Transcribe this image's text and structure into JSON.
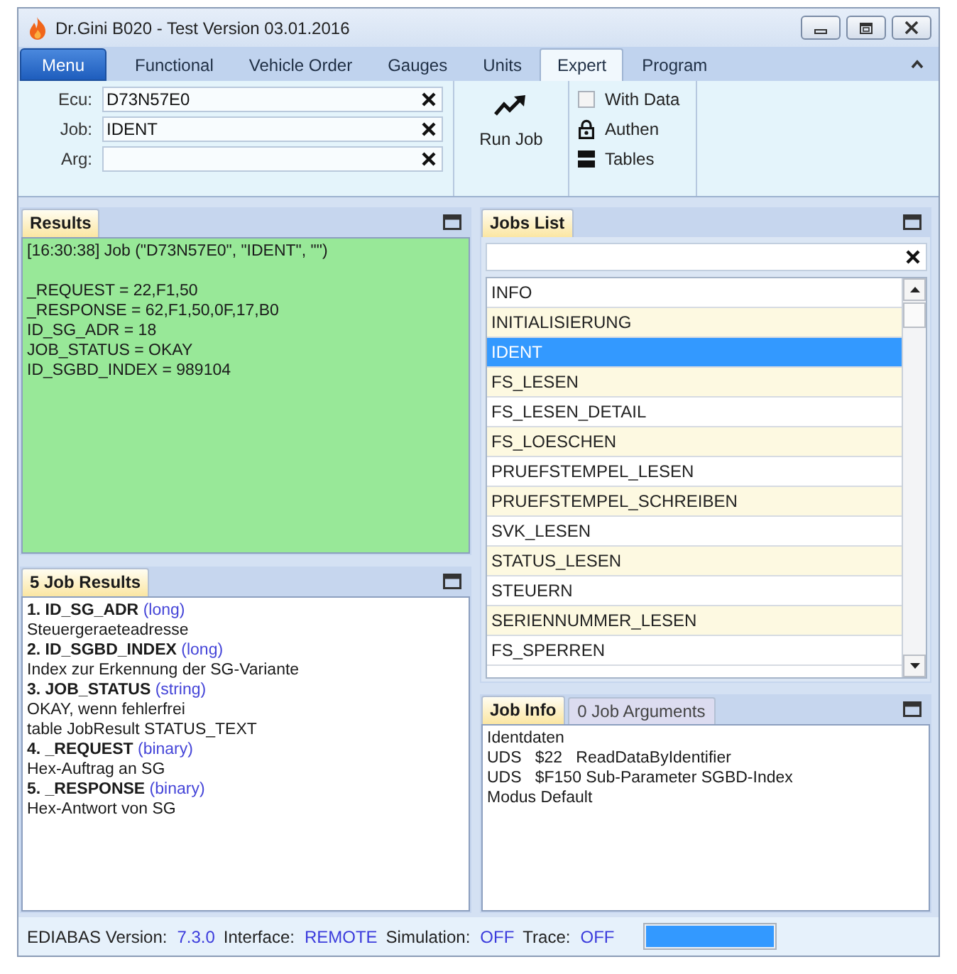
{
  "window": {
    "title": "Dr.Gini B020 - Test Version 03.01.2016"
  },
  "menu_button": "Menu",
  "tabs": [
    {
      "label": "Functional",
      "selected": false
    },
    {
      "label": "Vehicle Order",
      "selected": false
    },
    {
      "label": "Gauges",
      "selected": false
    },
    {
      "label": "Units",
      "selected": false
    },
    {
      "label": "Expert",
      "selected": true
    },
    {
      "label": "Program",
      "selected": false
    }
  ],
  "ribbon": {
    "fields": [
      {
        "label": "Ecu:",
        "value": "D73N57E0"
      },
      {
        "label": "Job:",
        "value": "IDENT"
      },
      {
        "label": "Arg:"
      }
    ],
    "run_button": "Run Job",
    "options": [
      {
        "kind": "checkbox",
        "label": "With Data",
        "checked": false
      },
      {
        "kind": "lock",
        "label": "Authen"
      },
      {
        "kind": "table",
        "label": "Tables"
      }
    ]
  },
  "results": {
    "title": "Results",
    "command": "[16:30:38] Job (\"D73N57E0\", \"IDENT\", \"\")",
    "lines": [
      "_REQUEST = 22,F1,50",
      "_RESPONSE = 62,F1,50,0F,17,B0",
      "ID_SG_ADR = 18",
      "JOB_STATUS = OKAY",
      "ID_SGBD_INDEX = 989104"
    ]
  },
  "jobs_list": {
    "title": "Jobs List",
    "jobs": [
      {
        "label": "INFO",
        "selected": false
      },
      {
        "label": "INITIALISIERUNG",
        "selected": false
      },
      {
        "label": "IDENT",
        "selected": true
      },
      {
        "label": "FS_LESEN",
        "selected": false
      },
      {
        "label": "FS_LESEN_DETAIL",
        "selected": false
      },
      {
        "label": "FS_LOESCHEN",
        "selected": false
      },
      {
        "label": "PRUEFSTEMPEL_LESEN",
        "selected": false
      },
      {
        "label": "PRUEFSTEMPEL_SCHREIBEN",
        "selected": false
      },
      {
        "label": "SVK_LESEN",
        "selected": false
      },
      {
        "label": "STATUS_LESEN",
        "selected": false
      },
      {
        "label": "STEUERN",
        "selected": false
      },
      {
        "label": "SERIENNUMMER_LESEN",
        "selected": false
      },
      {
        "label": "FS_SPERREN",
        "selected": false
      }
    ]
  },
  "job_results": {
    "title": "5 Job Results",
    "items": [
      {
        "name": "1. ID_SG_ADR",
        "type": "(long)",
        "description": [
          "Steuergeraeteadresse"
        ]
      },
      {
        "name": "2. ID_SGBD_INDEX",
        "type": "(long)",
        "description": [
          "Index zur Erkennung der SG-Variante"
        ]
      },
      {
        "name": "3. JOB_STATUS",
        "type": "(string)",
        "description": [
          "OKAY, wenn fehlerfrei",
          "table JobResult STATUS_TEXT"
        ]
      },
      {
        "name": "4. _REQUEST",
        "type": "(binary)",
        "description": [
          "Hex-Auftrag an SG"
        ]
      },
      {
        "name": "5. _RESPONSE",
        "type": "(binary)",
        "description": [
          "Hex-Antwort von SG"
        ]
      }
    ]
  },
  "job_info": {
    "tabs": [
      {
        "label": "Job Info",
        "selected": true
      },
      {
        "label": "0 Job Arguments",
        "selected": false
      }
    ],
    "lines": [
      "Identdaten",
      "UDS   $22   ReadDataByIdentifier",
      "UDS   $F150 Sub-Parameter SGBD-Index",
      "Modus Default"
    ]
  },
  "status_bar": {
    "items": [
      {
        "label": "EDIABAS Version:",
        "value": "7.3.0"
      },
      {
        "label": "Interface:",
        "value": "REMOTE"
      },
      {
        "label": "Simulation:",
        "value": "OFF"
      },
      {
        "label": "Trace:",
        "value": "OFF"
      }
    ],
    "progress": {
      "level": 1
    }
  }
}
